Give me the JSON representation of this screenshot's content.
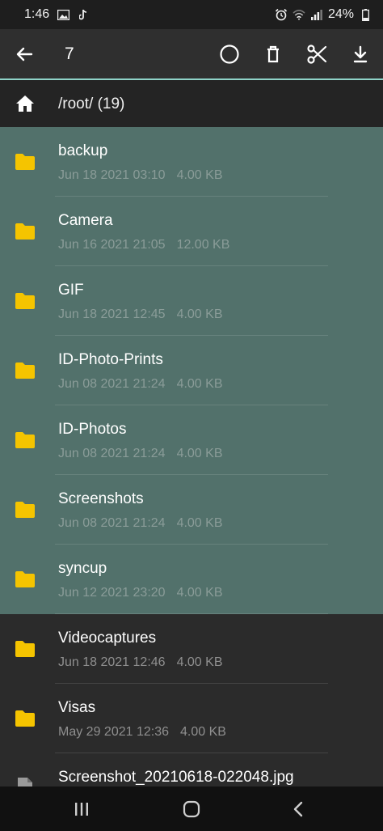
{
  "status_bar": {
    "time": "1:46",
    "battery": "24%"
  },
  "action_bar": {
    "selected_count": "7",
    "actions": [
      "select-all",
      "delete",
      "cut",
      "download"
    ]
  },
  "path": {
    "label": "/root/ (19)"
  },
  "files": [
    {
      "name": "backup",
      "date": "Jun 18 2021 03:10",
      "size": "4.00 KB",
      "type": "folder",
      "selected": true
    },
    {
      "name": "Camera",
      "date": "Jun 16 2021 21:05",
      "size": "12.00 KB",
      "type": "folder",
      "selected": true
    },
    {
      "name": "GIF",
      "date": "Jun 18 2021 12:45",
      "size": "4.00 KB",
      "type": "folder",
      "selected": true
    },
    {
      "name": "ID-Photo-Prints",
      "date": "Jun 08 2021 21:24",
      "size": "4.00 KB",
      "type": "folder",
      "selected": true
    },
    {
      "name": "ID-Photos",
      "date": "Jun 08 2021 21:24",
      "size": "4.00 KB",
      "type": "folder",
      "selected": true
    },
    {
      "name": "Screenshots",
      "date": "Jun 08 2021 21:24",
      "size": "4.00 KB",
      "type": "folder",
      "selected": true
    },
    {
      "name": "syncup",
      "date": "Jun 12 2021 23:20",
      "size": "4.00 KB",
      "type": "folder",
      "selected": true
    },
    {
      "name": "Videocaptures",
      "date": "Jun 18 2021 12:46",
      "size": "4.00 KB",
      "type": "folder",
      "selected": false
    },
    {
      "name": "Visas",
      "date": "May 29 2021 12:36",
      "size": "4.00 KB",
      "type": "folder",
      "selected": false
    },
    {
      "name": "Screenshot_20210618-022048.jpg",
      "date": "",
      "size": "",
      "type": "file",
      "selected": false
    }
  ],
  "colors": {
    "selected_row": "#52716b",
    "folder_icon": "#f5c400",
    "accent_line": "#8fd3c8",
    "background": "#2b2b2b"
  }
}
